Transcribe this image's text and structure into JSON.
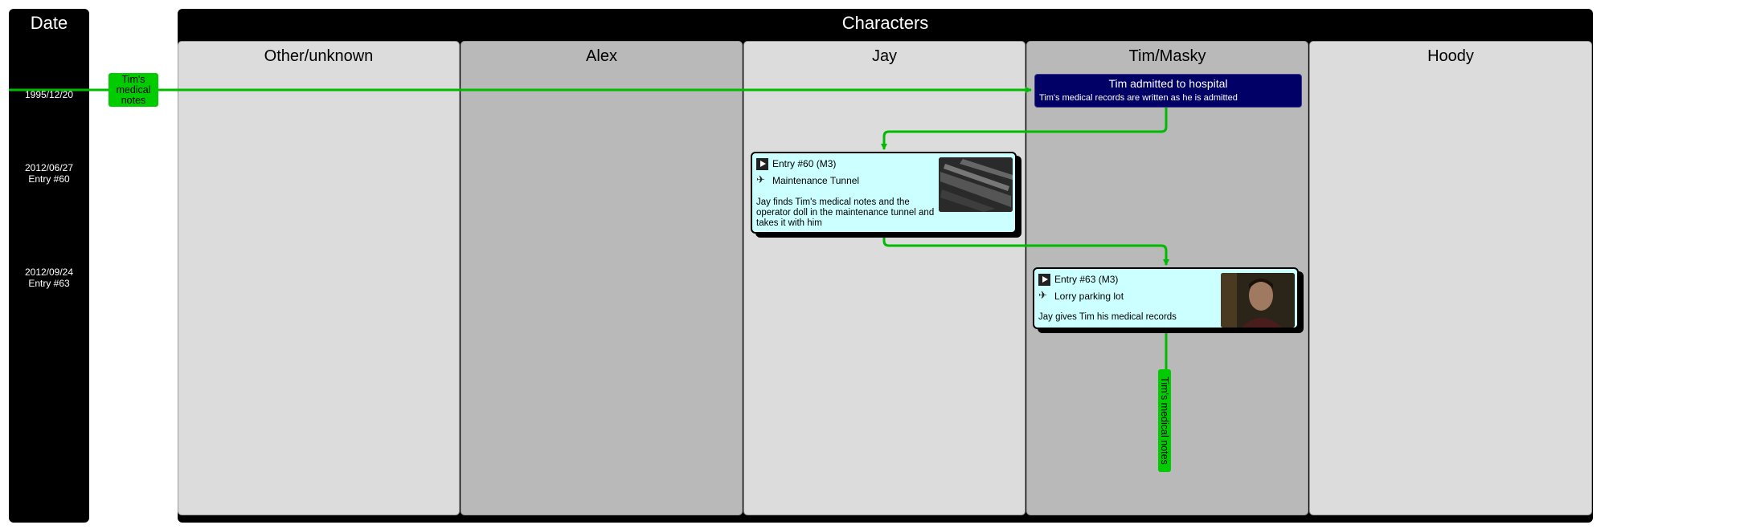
{
  "date_column": {
    "title": "Date",
    "rows": [
      {
        "lines": [
          "1995/12/20"
        ]
      },
      {
        "lines": [
          "2012/06/27",
          "Entry #60"
        ]
      },
      {
        "lines": [
          "2012/09/24",
          "Entry #63"
        ]
      }
    ]
  },
  "characters": {
    "title": "Characters",
    "lanes": [
      "Other/unknown",
      "Alex",
      "Jay",
      "Tim/Masky",
      "Hoody"
    ]
  },
  "object_tag": {
    "text": "Tim's medical notes"
  },
  "event": {
    "title": "Tim admitted to hospital",
    "description": "Tim's medical records are written as he is admitted"
  },
  "entries": [
    {
      "entry": "Entry #60 (M3)",
      "location": "Maintenance Tunnel",
      "description": "Jay finds Tim's medical notes and the operator doll in the maintenance tunnel and takes it with him"
    },
    {
      "entry": "Entry #63 (M3)",
      "location": "Lorry parking lot",
      "description": "Jay gives Tim his medical records"
    }
  ],
  "vertical_tag": {
    "text": "Tim's medical notes"
  },
  "colors": {
    "object": "#00cc00",
    "event": "#000066",
    "entry": "#ccffff",
    "lane_light": "#dcdcdc",
    "lane_dark": "#b9b9b9"
  },
  "icons": {
    "entry_type": "play-icon",
    "location": "pin-icon"
  }
}
